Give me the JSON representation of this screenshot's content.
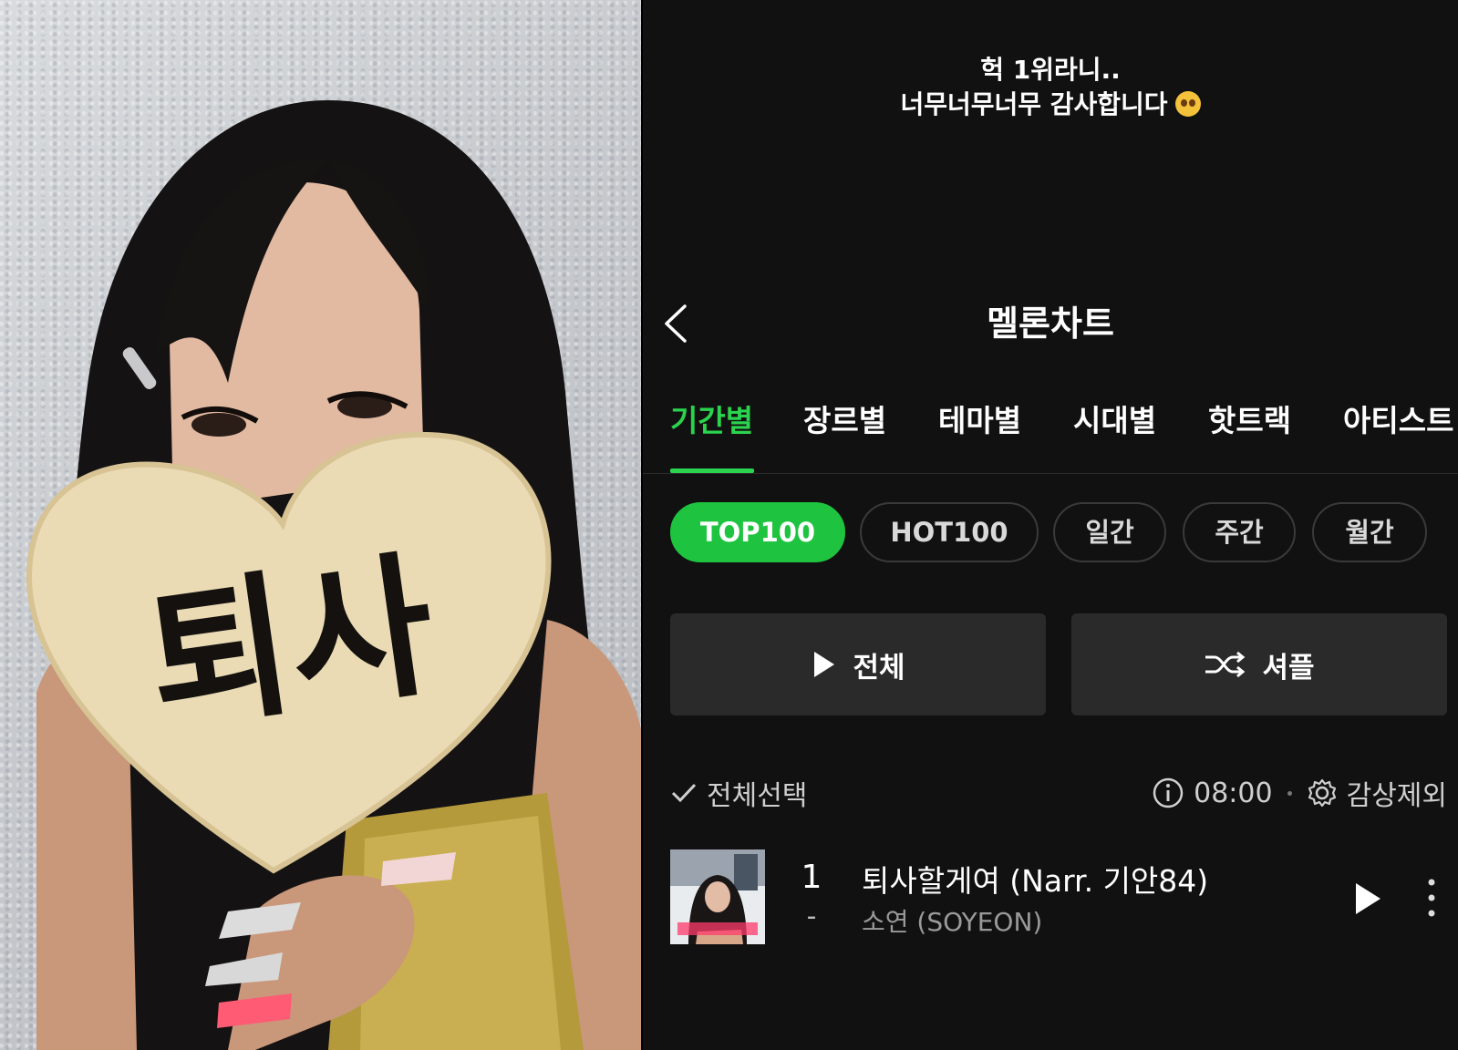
{
  "photo": {
    "fan_text": "퇴사",
    "top_color": "#d9dcdf",
    "fan_color": "#eadbb5"
  },
  "story": {
    "line1": "헉 1위라니..",
    "line2": "너무너무너무 감사합니다",
    "emoji": "pleading-face-emoji"
  },
  "header": {
    "title": "멜론차트",
    "back_icon": "chevron-left-icon"
  },
  "tabs": [
    {
      "label": "기간별",
      "active": true
    },
    {
      "label": "장르별",
      "active": false
    },
    {
      "label": "테마별",
      "active": false
    },
    {
      "label": "시대별",
      "active": false
    },
    {
      "label": "핫트랙",
      "active": false
    },
    {
      "label": "아티스트",
      "active": false
    }
  ],
  "chips": [
    {
      "label": "TOP100",
      "active": true
    },
    {
      "label": "HOT100",
      "active": false
    },
    {
      "label": "일간",
      "active": false
    },
    {
      "label": "주간",
      "active": false
    },
    {
      "label": "월간",
      "active": false
    }
  ],
  "actions": {
    "play_all": "전체",
    "shuffle": "셔플"
  },
  "toolbar": {
    "select_all": "전체선택",
    "time": "08:00",
    "exclude": "감상제외"
  },
  "song": {
    "rank": "1",
    "change": "-",
    "title": "퇴사할게여 (Narr. 기안84)",
    "artist": "소연 (SOYEON)"
  },
  "colors": {
    "accent": "#2bd44e",
    "chip_active": "#1ec43f",
    "background": "#111111"
  }
}
